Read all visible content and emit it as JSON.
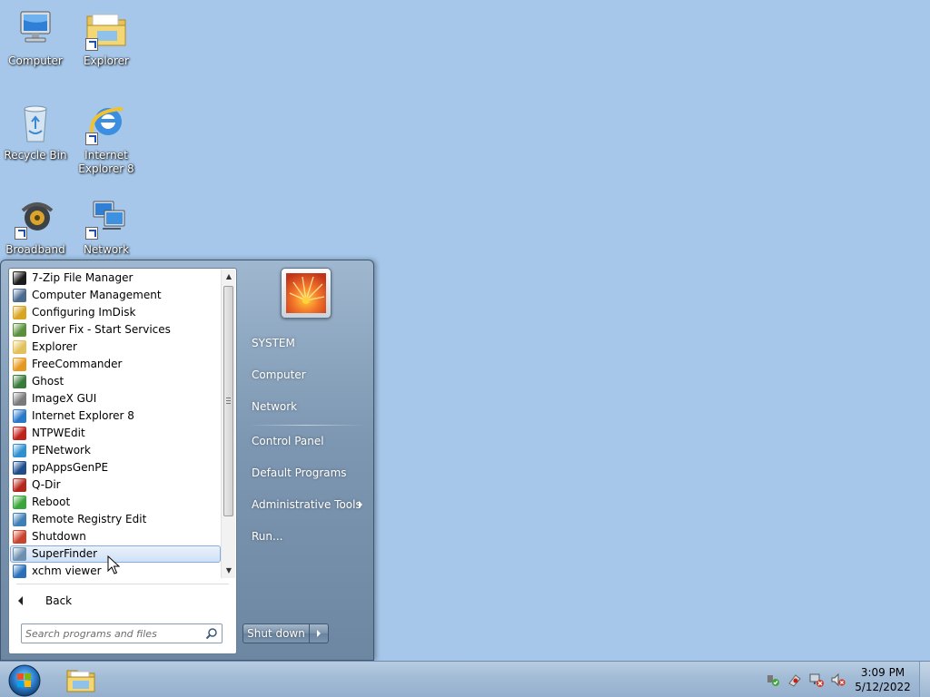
{
  "desktop": {
    "icons": [
      {
        "label": "Computer",
        "icon": "computer-icon"
      },
      {
        "label": "Explorer",
        "icon": "folder-icon"
      },
      {
        "label": "Recycle Bin",
        "icon": "recycle-bin-icon"
      },
      {
        "label": "Internet Explorer 8",
        "icon": "internet-explorer-icon"
      },
      {
        "label": "Broadband",
        "icon": "broadband-icon"
      },
      {
        "label": "Network",
        "icon": "network-icon"
      }
    ]
  },
  "start_menu": {
    "programs": [
      {
        "label": "7-Zip File Manager",
        "icon": "7zip-icon",
        "color": "#1b1b1b"
      },
      {
        "label": "Computer Management",
        "icon": "computer-management-icon",
        "color": "#4a6b8f"
      },
      {
        "label": "Configuring ImDisk",
        "icon": "imdisk-icon",
        "color": "#d9a420"
      },
      {
        "label": "Driver Fix - Start Services",
        "icon": "driver-fix-icon",
        "color": "#5a8f3c"
      },
      {
        "label": "Explorer",
        "icon": "explorer-folder-icon",
        "color": "#e3c15a"
      },
      {
        "label": "FreeCommander",
        "icon": "freecommander-icon",
        "color": "#e59a1f"
      },
      {
        "label": "Ghost",
        "icon": "ghost-icon",
        "color": "#3a7a3a"
      },
      {
        "label": "ImageX GUI",
        "icon": "imagex-icon",
        "color": "#7a7a7a"
      },
      {
        "label": "Internet Explorer 8",
        "icon": "ie-icon",
        "color": "#2a78c9"
      },
      {
        "label": "NTPWEdit",
        "icon": "ntpwedit-icon",
        "color": "#c0221c"
      },
      {
        "label": "PENetwork",
        "icon": "penetwork-icon",
        "color": "#2f8fd0"
      },
      {
        "label": "ppAppsGenPE",
        "icon": "ppapps-icon",
        "color": "#1e4d8a"
      },
      {
        "label": "Q-Dir",
        "icon": "qdir-icon",
        "color": "#b4251c"
      },
      {
        "label": "Reboot",
        "icon": "reboot-icon",
        "color": "#3aa53a"
      },
      {
        "label": "Remote Registry Edit",
        "icon": "registry-icon",
        "color": "#3f7fb5"
      },
      {
        "label": "Shutdown",
        "icon": "shutdown-icon",
        "color": "#c9432e"
      },
      {
        "label": "SuperFinder",
        "icon": "superfinder-icon",
        "color": "#6d8fb0",
        "selected": true
      },
      {
        "label": "xchm viewer",
        "icon": "xchm-icon",
        "color": "#2a6fb8"
      }
    ],
    "back_label": "Back",
    "search": {
      "placeholder": "Search programs and files"
    },
    "right_items": [
      {
        "label": "SYSTEM",
        "has_submenu": false
      },
      {
        "label": "Computer",
        "has_submenu": false
      },
      {
        "label": "Network",
        "has_submenu": false
      },
      {
        "label": "Control Panel",
        "has_submenu": false
      },
      {
        "label": "Default Programs",
        "has_submenu": false
      },
      {
        "label": "Administrative Tools",
        "has_submenu": true
      },
      {
        "label": "Run...",
        "has_submenu": false
      }
    ],
    "shutdown_label": "Shut down"
  },
  "taskbar": {
    "pinned": [
      {
        "icon": "explorer-folder-icon"
      }
    ],
    "tray_icons": [
      "safely-remove-icon",
      "network-tray-icon",
      "network-disconnected-icon",
      "volume-muted-icon"
    ],
    "clock": {
      "time": "3:09 PM",
      "date": "5/12/2022"
    }
  },
  "colors": {
    "desktop_bg": "#a6c7ea",
    "selection_border": "#84acdd",
    "menu_dark": "#6d87a3"
  }
}
